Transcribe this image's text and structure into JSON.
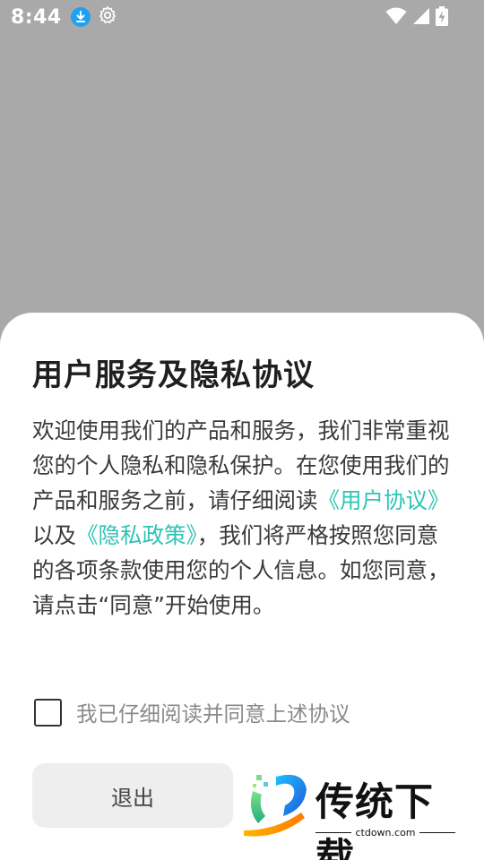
{
  "status_bar": {
    "time": "8:44",
    "icons": [
      "download-icon",
      "gear-icon",
      "wifi-icon",
      "signal-icon",
      "battery-charging-icon"
    ]
  },
  "dialog": {
    "title": "用户服务及隐私协议",
    "body": {
      "part1": "欢迎使用我们的产品和服务，我们非常重视您的个人隐私和隐私保护。在您使用我们的产品和服务之前，请仔细阅读",
      "link_user_agreement": "《用户协议》",
      "part2": "以及",
      "link_privacy_policy": "《隐私政策》",
      "part3": "，我们将严格按照您同意的各项条款使用您的个人信息。如您同意，请点击“同意”开始使用。"
    },
    "consent_label": "我已仔细阅读并同意上述协议",
    "consent_checked": false,
    "exit_label": "退出"
  },
  "watermark": {
    "brand": "传统下载",
    "url": "ctdown.com"
  },
  "colors": {
    "link": "#2ec4b6",
    "overlay": "#a9a9a9",
    "download_badge": "#1ea1f2"
  }
}
